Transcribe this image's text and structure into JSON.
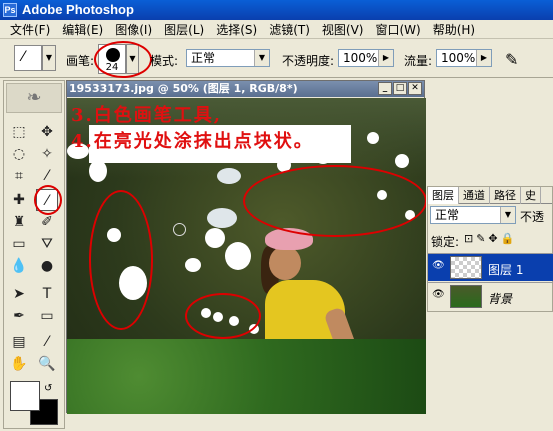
{
  "app": {
    "title": "Adobe Photoshop"
  },
  "menu": [
    "文件(F)",
    "编辑(E)",
    "图像(I)",
    "图层(L)",
    "选择(S)",
    "滤镜(T)",
    "视图(V)",
    "窗口(W)",
    "帮助(H)"
  ],
  "options": {
    "brush_label": "画笔:",
    "brush_size": "24",
    "mode_label": "模式:",
    "mode_value": "正常",
    "opacity_label": "不透明度:",
    "opacity_value": "100%",
    "flow_label": "流量:",
    "flow_value": "100%"
  },
  "document": {
    "title": "19533173.jpg @ 50% (图层 1, RGB/8*)",
    "annotation_line1": "3.白色画笔工具,",
    "annotation_line2": "4.在亮光处涂抹出点块状。"
  },
  "layers_panel": {
    "tabs": [
      "图层",
      "通道",
      "路径",
      "史"
    ],
    "blend_mode": "正常",
    "opacity_label": "不透",
    "lock_label": "锁定:",
    "layers": [
      {
        "name": "图层 1",
        "selected": true
      },
      {
        "name": "背景",
        "selected": false
      }
    ]
  },
  "colors": {
    "annotation_red": "#e01010",
    "foreground": "#ffffff",
    "background": "#000000"
  }
}
